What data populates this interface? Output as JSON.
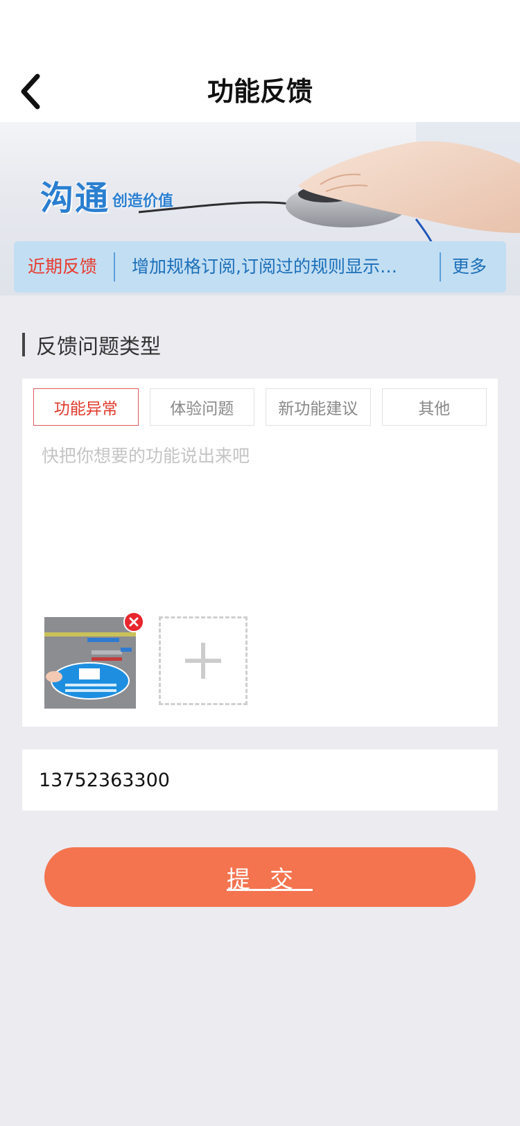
{
  "header": {
    "title": "功能反馈",
    "back_icon": "chevron-left-icon"
  },
  "banner": {
    "slogan_main": "沟通",
    "slogan_sub": "创造价值",
    "art": "hand-on-mouse-illustration"
  },
  "recent_feedback": {
    "label": "近期反馈",
    "latest_text": "增加规格订阅,订阅过的规则显示…",
    "more_label": "更多"
  },
  "feedback_form": {
    "section_title": "反馈问题类型",
    "types": [
      {
        "label": "功能异常",
        "selected": true
      },
      {
        "label": "体验问题",
        "selected": false
      },
      {
        "label": "新功能建议",
        "selected": false
      },
      {
        "label": "其他",
        "selected": false
      }
    ],
    "textarea_placeholder": "快把你想要的功能说出来吧",
    "textarea_value": "",
    "attachments_count": 1,
    "remove_icon": "close-circle-icon",
    "add_icon": "plus-icon"
  },
  "contact": {
    "value": "13752363300"
  },
  "submit": {
    "label": "提交"
  },
  "colors": {
    "accent_red": "#e0392b",
    "submit_orange": "#f4744f",
    "link_blue": "#1c6fb8",
    "strip_bg": "#c2def3",
    "page_bg": "#ebebf0"
  }
}
